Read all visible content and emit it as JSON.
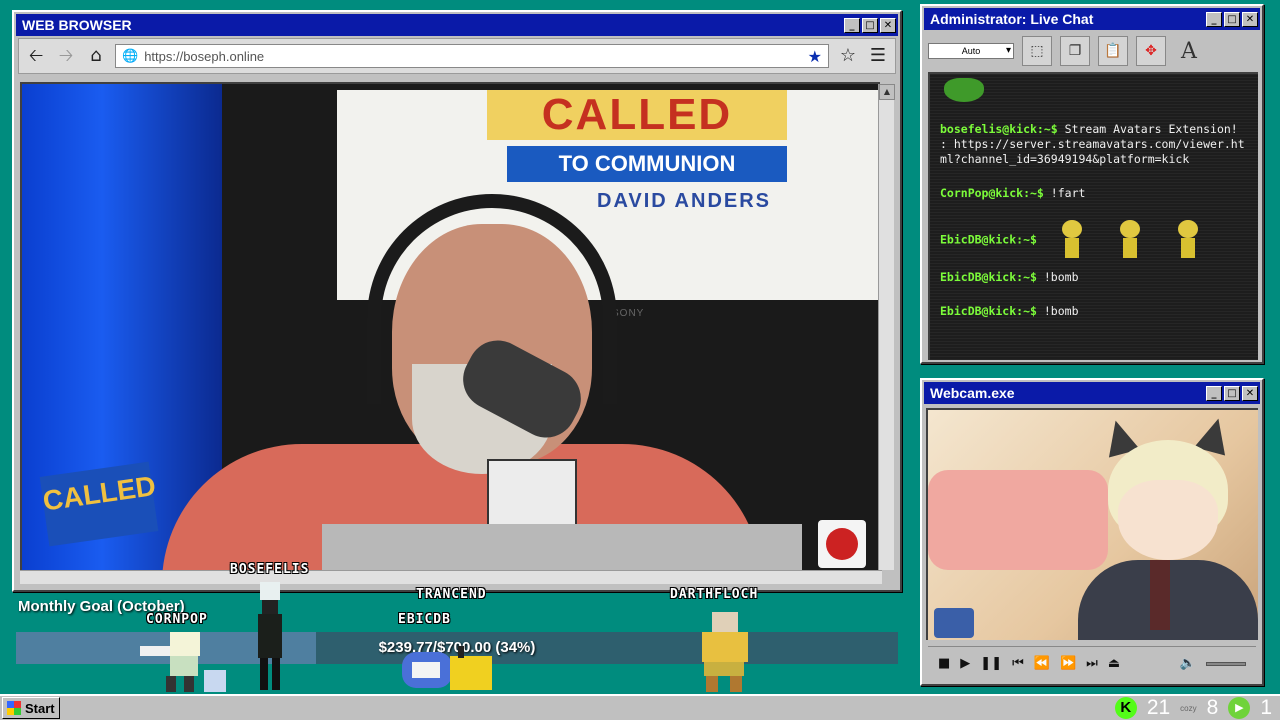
{
  "browser": {
    "title": "WEB BROWSER",
    "url": "https://boseph.online",
    "video": {
      "banner_line1": "CALLED",
      "banner_line2": "TO COMMUNION",
      "banner_line3": "DAVID ANDERS",
      "small_logo": "CALLED",
      "brand": "SONY"
    }
  },
  "window_buttons": {
    "minimize": "_",
    "maximize": "□",
    "close": "✕"
  },
  "chat": {
    "title": "Administrator: Live Chat",
    "font_size_select": "Auto",
    "messages": [
      {
        "user": "bosefelis@kick:~$",
        "text": "Stream Avatars Extension! : https://server.streamavatars.com/viewer.html?channel_id=36949194&platform=kick"
      },
      {
        "user": "CornPop@kick:~$",
        "text": "!fart"
      },
      {
        "user": "EbicDB@kick:~$",
        "text": ""
      },
      {
        "user": "EbicDB@kick:~$",
        "text": "!bomb"
      },
      {
        "user": "EbicDB@kick:~$",
        "text": "!bomb"
      }
    ]
  },
  "webcam": {
    "title": "Webcam.exe"
  },
  "goal": {
    "label": "Monthly Goal (October)",
    "text": "$239.77/$700.00 (34%)",
    "fraction": 0.34
  },
  "avatars": {
    "bosefelis": "BOSEFELIS",
    "cornpop": "CORNPOP",
    "trancend": "TRANCEND",
    "ebicdb": "EBICDB",
    "darthfloch": "DARTHFLOCH"
  },
  "taskbar": {
    "start": "Start",
    "count_kick": "21",
    "cozy": "cozy",
    "count_cozy": "8",
    "count_play": "1"
  },
  "colors": {
    "desktop": "#008c7e",
    "titlebar": "#0a1aa8",
    "chat_user": "#7cfc3a",
    "kick_green": "#53fc18"
  }
}
